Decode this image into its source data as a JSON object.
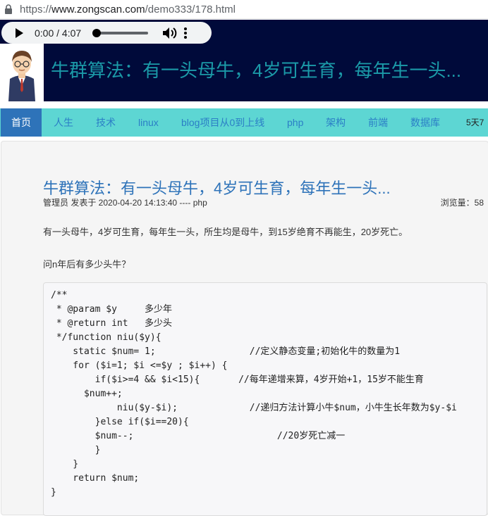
{
  "address_bar": {
    "url_prefix": "https://",
    "url_domain": "www.zongscan.com",
    "url_path": "/demo333/178.html"
  },
  "audio_player": {
    "time": "0:00 / 4:07",
    "progress": 0
  },
  "banner": {
    "title": "牛群算法：有一头母牛，4岁可生育，每年生一头..."
  },
  "nav": {
    "items": [
      "首页",
      "人生",
      "技术",
      "linux",
      "blog项目从0到上线",
      "php",
      "架构",
      "前端",
      "数据库"
    ],
    "active": "首页",
    "side_text": "5天7"
  },
  "article": {
    "title": "牛群算法：有一头母牛，4岁可生育，每年生一头...",
    "meta": "管理员 发表于 2020-04-20 14:13:40 ---- php",
    "views": "浏览量：58",
    "para1": "有一头母牛，4岁可生育，每年生一头，所生均是母牛，到15岁绝育不再能生，20岁死亡。",
    "para2": "问n年后有多少头牛？",
    "code_lines": [
      "/**",
      " * @param $y     多少年",
      " * @return int   多少头",
      " */function niu($y){",
      "    static $num= 1;                 //定义静态变量;初始化牛的数量为1",
      "    for ($i=1; $i <=$y ; $i++) {",
      "        if($i>=4 && $i<15){       //每年递增来算，4岁开始+1，15岁不能生育",
      "      $num++;",
      "            niu($y-$i);             //递归方法计算小牛$num，小牛生长年数为$y-$i",
      "        }else if($i==20){",
      "        $num--;                          //20岁死亡减一",
      "        }",
      "    }",
      "    return $num;",
      "}"
    ]
  },
  "colors": {
    "banner_bg": "#000a3a",
    "banner_title": "#1b9aa8",
    "nav_bg": "#5dd6d3",
    "nav_active": "#2e73b9",
    "link": "#2e73b9"
  },
  "icons": [
    "lock-icon",
    "play-icon",
    "volume-icon",
    "more-options-icon",
    "avatar-image"
  ]
}
